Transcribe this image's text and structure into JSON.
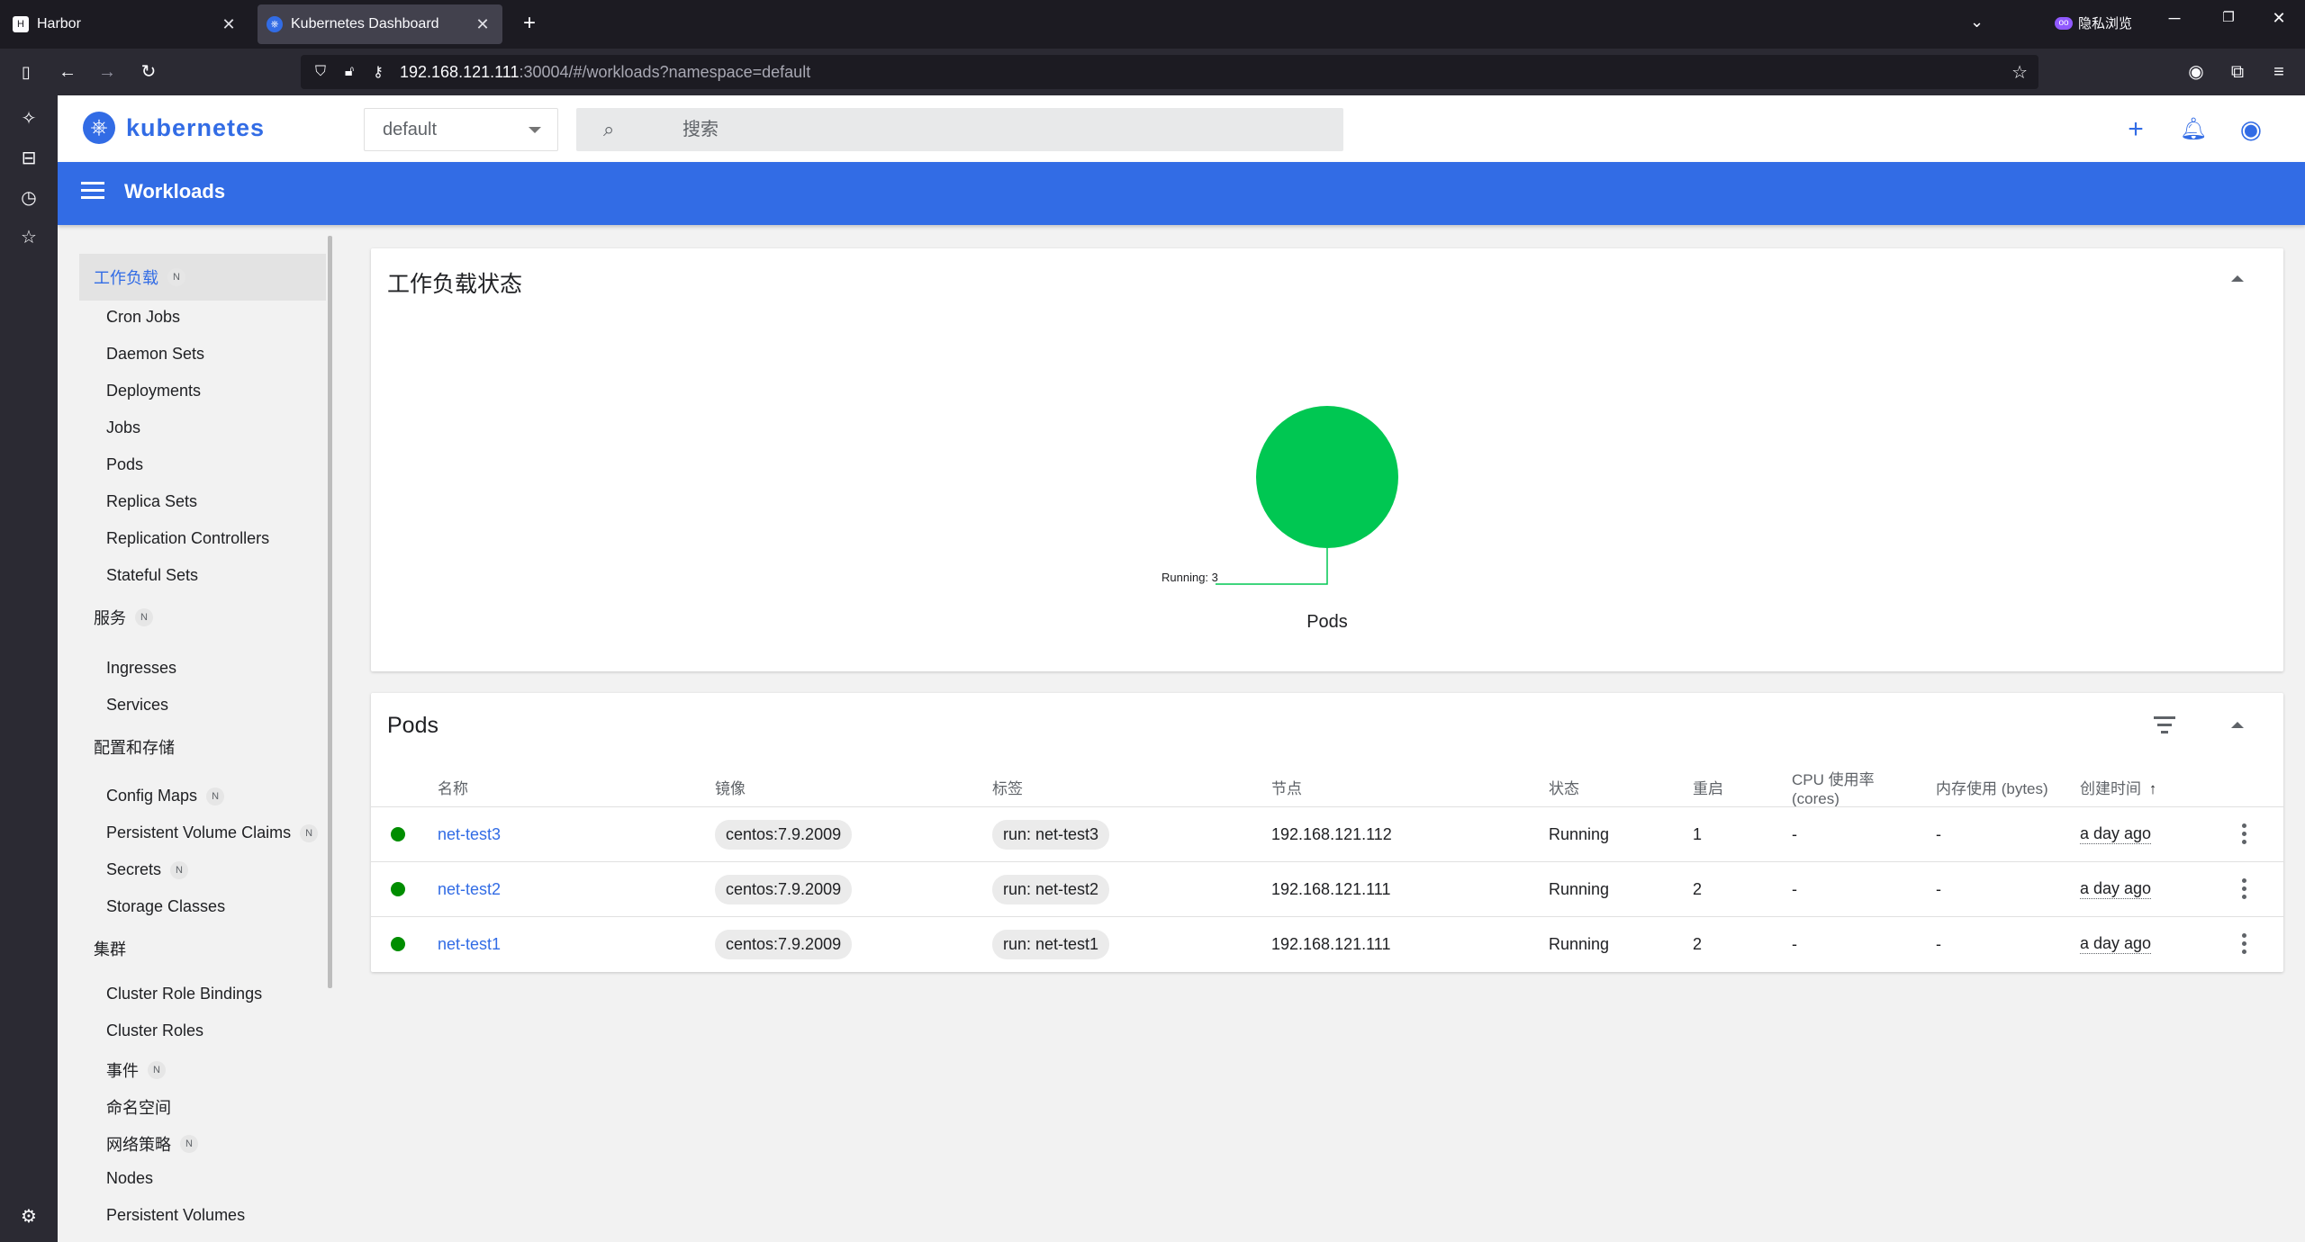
{
  "browser": {
    "tabs": [
      {
        "label": "Harbor"
      },
      {
        "label": "Kubernetes Dashboard"
      }
    ],
    "private_label": "隐私浏览",
    "url_host": "192.168.121.111",
    "url_rest": ":30004/#/workloads?namespace=default"
  },
  "app": {
    "logo_text": "kubernetes",
    "namespace": "default",
    "search_placeholder": "搜索",
    "header_title": "Workloads"
  },
  "nav": {
    "workloads": {
      "label": "工作负载",
      "badge": "N",
      "items": [
        "Cron Jobs",
        "Daemon Sets",
        "Deployments",
        "Jobs",
        "Pods",
        "Replica Sets",
        "Replication Controllers",
        "Stateful Sets"
      ]
    },
    "service": {
      "label": "服务",
      "badge": "N",
      "items": [
        "Ingresses",
        "Services"
      ]
    },
    "config": {
      "label": "配置和存储",
      "items": [
        {
          "label": "Config Maps",
          "badge": "N"
        },
        {
          "label": "Persistent Volume Claims",
          "badge": "N"
        },
        {
          "label": "Secrets",
          "badge": "N"
        },
        {
          "label": "Storage Classes"
        }
      ]
    },
    "cluster": {
      "label": "集群",
      "items": [
        {
          "label": "Cluster Role Bindings"
        },
        {
          "label": "Cluster Roles"
        },
        {
          "label": "事件",
          "badge": "N"
        },
        {
          "label": "命名空间"
        },
        {
          "label": "网络策略",
          "badge": "N"
        },
        {
          "label": "Nodes"
        },
        {
          "label": "Persistent Volumes"
        }
      ]
    }
  },
  "status_card": {
    "title": "工作负载状态",
    "chart_label": "Running: 3",
    "chart_title": "Pods"
  },
  "chart_data": {
    "type": "pie",
    "title": "Pods",
    "categories": [
      "Running"
    ],
    "values": [
      3
    ],
    "colors": [
      "#00c752"
    ]
  },
  "pods_card": {
    "title": "Pods",
    "headers": {
      "name": "名称",
      "image": "镜像",
      "labels": "标签",
      "node": "节点",
      "status": "状态",
      "restarts": "重启",
      "cpu_line1": "CPU 使用率",
      "cpu_line2": "(cores)",
      "memory": "内存使用 (bytes)",
      "created": "创建时间",
      "sort_arrow": "↑"
    },
    "rows": [
      {
        "name": "net-test3",
        "image": "centos:7.9.2009",
        "label": "run: net-test3",
        "node": "192.168.121.112",
        "status": "Running",
        "restarts": "1",
        "cpu": "-",
        "memory": "-",
        "created": "a day ago"
      },
      {
        "name": "net-test2",
        "image": "centos:7.9.2009",
        "label": "run: net-test2",
        "node": "192.168.121.111",
        "status": "Running",
        "restarts": "2",
        "cpu": "-",
        "memory": "-",
        "created": "a day ago"
      },
      {
        "name": "net-test1",
        "image": "centos:7.9.2009",
        "label": "run: net-test1",
        "node": "192.168.121.111",
        "status": "Running",
        "restarts": "2",
        "cpu": "-",
        "memory": "-",
        "created": "a day ago"
      }
    ]
  },
  "colors": {
    "brand": "#326ce5",
    "running": "#008d00",
    "chart_green": "#00c752"
  }
}
